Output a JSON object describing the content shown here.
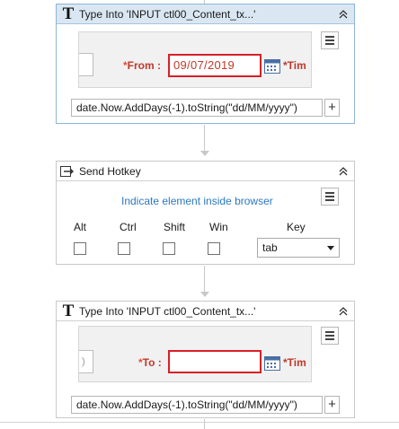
{
  "activities": [
    {
      "title": "Type Into 'INPUT  ctl00_Content_tx...'",
      "icon": "type-into-icon",
      "screenshot": {
        "label_star": "*",
        "label": "From :",
        "value": "09/07/2019",
        "clipped_label": "*Tim"
      },
      "expression": "date.Now.AddDays(-1).toString(\"dd/MM/yyyy\")",
      "add_button": "+"
    },
    {
      "title": "Send Hotkey",
      "icon": "send-hotkey-icon",
      "indicate_link": "Indicate element inside browser",
      "modifiers": [
        {
          "label": "Alt",
          "checked": false
        },
        {
          "label": "Ctrl",
          "checked": false
        },
        {
          "label": "Shift",
          "checked": false
        },
        {
          "label": "Win",
          "checked": false
        }
      ],
      "key_label": "Key",
      "key_value": "tab"
    },
    {
      "title": "Type Into 'INPUT  ctl00_Content_tx...'",
      "icon": "type-into-icon",
      "screenshot": {
        "stub_text": ")",
        "label_star": "*",
        "label": "To :",
        "value": "",
        "clipped_label": "*Tim"
      },
      "expression": "date.Now.AddDays(-1).toString(\"dd/MM/yyyy\")",
      "add_button": "+"
    }
  ],
  "colors": {
    "selected_header": "#dae7f3",
    "highlight_border": "#d81f26",
    "link": "#2c78c0",
    "label_red": "#c0392b"
  }
}
